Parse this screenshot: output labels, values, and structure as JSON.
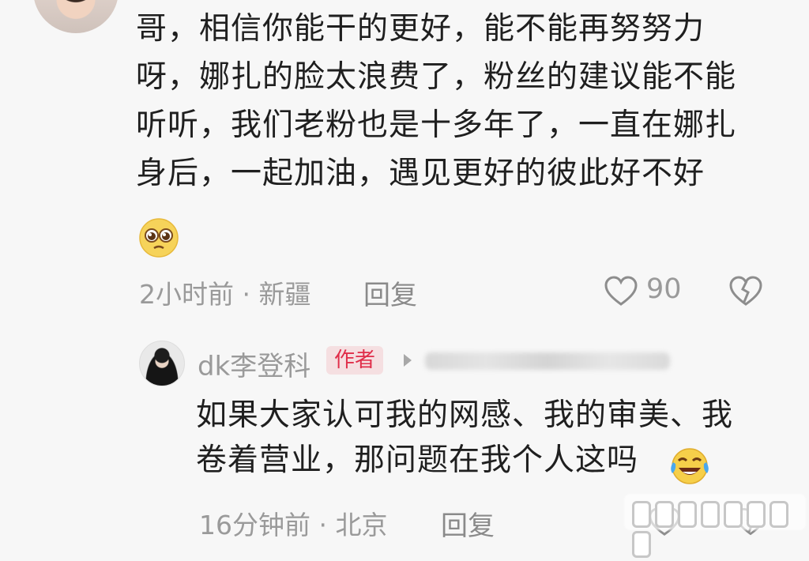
{
  "comment": {
    "text": "哥，相信你能干的更好，能不能再努努力\n呀，娜扎的脸太浪费了，粉丝的建议能不能\n听听，我们老粉也是十多年了，一直在娜扎\n身后，一起加油，遇见更好的彼此好不好",
    "emoji": "pleading-face",
    "meta": "2小时前 · 新疆",
    "reply_label": "回复",
    "like_count": "90"
  },
  "reply": {
    "author": "dk李登科",
    "badge": "作者",
    "text": "如果大家认可我的网感、我的审美、我\n卷着营业，那问题在我个人这吗",
    "emoji": "tears-of-joy",
    "meta": "16分钟前 · 北京",
    "reply_label": "回复"
  },
  "colors": {
    "background": "#f7f7f7",
    "text": "#1f1f1f",
    "meta": "#9a9a9a",
    "badge_bg": "#f5dfe1",
    "badge_text": "#e02e4a"
  }
}
